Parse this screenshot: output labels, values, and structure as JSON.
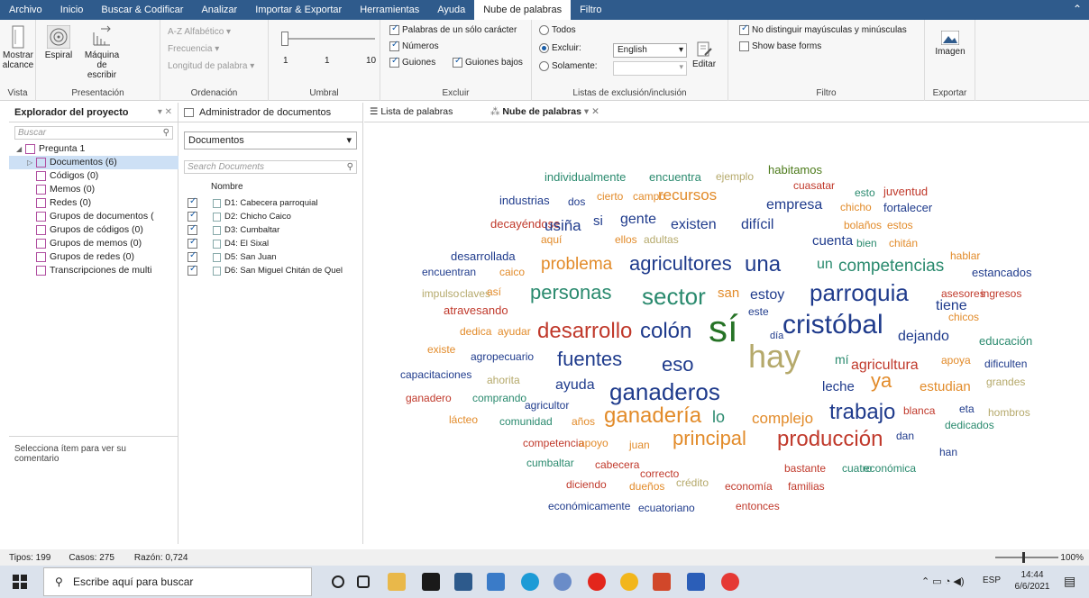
{
  "menu": {
    "tabs": [
      "Archivo",
      "Inicio",
      "Buscar & Codificar",
      "Analizar",
      "Importar & Exportar",
      "Herramientas",
      "Ayuda",
      "Nube de palabras",
      "Filtro"
    ],
    "active": "Nube de palabras"
  },
  "ribbon": {
    "vista": {
      "label": "Vista",
      "mostrar": "Mostrar alcance"
    },
    "presentacion": {
      "label": "Presentación",
      "espiral": "Espiral",
      "maquina": "Máquina de escribir"
    },
    "ordenacion": {
      "label": "Ordenación",
      "alfabetico": "A-Z Alfabético",
      "frecuencia": "Frecuencia",
      "longitud": "Longitud de palabra"
    },
    "umbral": {
      "label": "Umbral",
      "tick_min": "1",
      "tick_mid": "1",
      "tick_max": "10",
      "value": 1
    },
    "excluir": {
      "label": "Excluir",
      "palabras": "Palabras de un sólo carácter",
      "numeros": "Números",
      "guiones": "Guiones",
      "guiones_bajos": "Guiones bajos"
    },
    "listas": {
      "label": "Listas de exclusión/inclusión",
      "todos": "Todos",
      "excluir": "Excluir:",
      "solamente": "Solamente:",
      "language": "English",
      "editar": "Editar"
    },
    "filtro": {
      "label": "Filtro",
      "no_distinguir": "No distinguir mayúsculas y minúsculas",
      "show_base": "Show base forms"
    },
    "exportar": {
      "label": "Exportar",
      "imagen": "Imagen"
    }
  },
  "left_pane": {
    "title": "Explorador del proyecto",
    "search_placeholder": "Buscar",
    "tree": [
      {
        "label": "Pregunta 1",
        "level": 0
      },
      {
        "label": "Documentos (6)",
        "level": 1,
        "selected": true
      },
      {
        "label": "Códigos (0)",
        "level": 1
      },
      {
        "label": "Memos (0)",
        "level": 1
      },
      {
        "label": "Redes (0)",
        "level": 1
      },
      {
        "label": "Grupos de documentos (",
        "level": 1
      },
      {
        "label": "Grupos de códigos (0)",
        "level": 1
      },
      {
        "label": "Grupos de memos (0)",
        "level": 1
      },
      {
        "label": "Grupos de redes (0)",
        "level": 1
      },
      {
        "label": "Transcripciones de multi",
        "level": 1
      }
    ],
    "comment_hint": "Selecciona ítem para ver su comentario"
  },
  "mid_pane": {
    "tab_label": "Administrador de documentos",
    "dropdown": "Documentos",
    "search_placeholder": "Search Documents",
    "column": "Nombre",
    "docs": [
      "D1: Cabecera parroquial",
      "D2: Chicho Caico",
      "D3: Cumbaltar",
      "D4: El Sixal",
      "D5: San Juan",
      "D6: San Miguel Chitán de Quel"
    ]
  },
  "tabs": {
    "lista": "Lista de palabras",
    "nube": "Nube de palabras"
  },
  "cloud": [
    {
      "t": "individualmente",
      "c": "#2a8a6e",
      "s": 13
    },
    {
      "t": "encuentra",
      "c": "#2a8a6e",
      "s": 13
    },
    {
      "t": "ejemplo",
      "c": "#b5a96b",
      "s": 12
    },
    {
      "t": "habitamos",
      "c": "#4c7a1a",
      "s": 13
    },
    {
      "t": "cuasatar",
      "c": "#c0392b",
      "s": 12
    },
    {
      "t": "esto",
      "c": "#2a8a6e",
      "s": 12
    },
    {
      "t": "juventud",
      "c": "#c0392b",
      "s": 13
    },
    {
      "t": "industrias",
      "c": "#1f3b8c",
      "s": 13
    },
    {
      "t": "dos",
      "c": "#1f3b8c",
      "s": 12
    },
    {
      "t": "cierto",
      "c": "#e28b2a",
      "s": 12
    },
    {
      "t": "campo",
      "c": "#e28b2a",
      "s": 12
    },
    {
      "t": "recursos",
      "c": "#e28b2a",
      "s": 17
    },
    {
      "t": "empresa",
      "c": "#1f3b8c",
      "s": 16
    },
    {
      "t": "chicho",
      "c": "#e28b2a",
      "s": 12
    },
    {
      "t": "fortalecer",
      "c": "#1f3b8c",
      "s": 13
    },
    {
      "t": "decayéndose",
      "c": "#c0392b",
      "s": 13
    },
    {
      "t": "usiña",
      "c": "#1f3b8c",
      "s": 17
    },
    {
      "t": "si",
      "c": "#1f3b8c",
      "s": 15
    },
    {
      "t": "gente",
      "c": "#1f3b8c",
      "s": 16
    },
    {
      "t": "existen",
      "c": "#1f3b8c",
      "s": 16
    },
    {
      "t": "difícil",
      "c": "#1f3b8c",
      "s": 16
    },
    {
      "t": "bolaños",
      "c": "#e28b2a",
      "s": 12
    },
    {
      "t": "estos",
      "c": "#e28b2a",
      "s": 12
    },
    {
      "t": "aquí",
      "c": "#e28b2a",
      "s": 12
    },
    {
      "t": "ellos",
      "c": "#e28b2a",
      "s": 12
    },
    {
      "t": "adultas",
      "c": "#b5a96b",
      "s": 12
    },
    {
      "t": "cuenta",
      "c": "#1f3b8c",
      "s": 15
    },
    {
      "t": "bien",
      "c": "#2a8a6e",
      "s": 12
    },
    {
      "t": "chitán",
      "c": "#e28b2a",
      "s": 12
    },
    {
      "t": "desarrollada",
      "c": "#1f3b8c",
      "s": 13
    },
    {
      "t": "hablar",
      "c": "#e28b2a",
      "s": 12
    },
    {
      "t": "encuentran",
      "c": "#1f3b8c",
      "s": 12
    },
    {
      "t": "caico",
      "c": "#e28b2a",
      "s": 12
    },
    {
      "t": "problema",
      "c": "#e28b2a",
      "s": 19
    },
    {
      "t": "agricultores",
      "c": "#1f3b8c",
      "s": 22
    },
    {
      "t": "una",
      "c": "#1f3b8c",
      "s": 24
    },
    {
      "t": "un",
      "c": "#2a8a6e",
      "s": 16
    },
    {
      "t": "competencias",
      "c": "#2a8a6e",
      "s": 19
    },
    {
      "t": "estancados",
      "c": "#1f3b8c",
      "s": 13
    },
    {
      "t": "impulso",
      "c": "#b5a96b",
      "s": 12
    },
    {
      "t": "claves",
      "c": "#b5a96b",
      "s": 12
    },
    {
      "t": "así",
      "c": "#e28b2a",
      "s": 12
    },
    {
      "t": "personas",
      "c": "#2a8a6e",
      "s": 22
    },
    {
      "t": "sector",
      "c": "#2a8a6e",
      "s": 26
    },
    {
      "t": "san",
      "c": "#e28b2a",
      "s": 15
    },
    {
      "t": "estoy",
      "c": "#1f3b8c",
      "s": 16
    },
    {
      "t": "parroquia",
      "c": "#1f3b8c",
      "s": 26
    },
    {
      "t": "asesores",
      "c": "#c0392b",
      "s": 12
    },
    {
      "t": "ingresos",
      "c": "#c0392b",
      "s": 12
    },
    {
      "t": "atravesando",
      "c": "#c0392b",
      "s": 13
    },
    {
      "t": "este",
      "c": "#1f3b8c",
      "s": 12
    },
    {
      "t": "tiene",
      "c": "#1f3b8c",
      "s": 16
    },
    {
      "t": "chicos",
      "c": "#e28b2a",
      "s": 12
    },
    {
      "t": "dedica",
      "c": "#e28b2a",
      "s": 12
    },
    {
      "t": "ayudar",
      "c": "#e28b2a",
      "s": 12
    },
    {
      "t": "desarrollo",
      "c": "#c0392b",
      "s": 24
    },
    {
      "t": "colón",
      "c": "#1f3b8c",
      "s": 24
    },
    {
      "t": "sí",
      "c": "#267326",
      "s": 42
    },
    {
      "t": "día",
      "c": "#1f3b8c",
      "s": 11
    },
    {
      "t": "cristóbal",
      "c": "#1f3b8c",
      "s": 30
    },
    {
      "t": "dejando",
      "c": "#1f3b8c",
      "s": 16
    },
    {
      "t": "educación",
      "c": "#2a8a6e",
      "s": 13
    },
    {
      "t": "existe",
      "c": "#e28b2a",
      "s": 12
    },
    {
      "t": "agropecuario",
      "c": "#1f3b8c",
      "s": 12
    },
    {
      "t": "fuentes",
      "c": "#1f3b8c",
      "s": 22
    },
    {
      "t": "eso",
      "c": "#1f3b8c",
      "s": 22
    },
    {
      "t": "hay",
      "c": "#b5a96b",
      "s": 36
    },
    {
      "t": "mí",
      "c": "#2a8a6e",
      "s": 14
    },
    {
      "t": "agricultura",
      "c": "#c0392b",
      "s": 16
    },
    {
      "t": "apoya",
      "c": "#e28b2a",
      "s": 12
    },
    {
      "t": "dificulten",
      "c": "#1f3b8c",
      "s": 12
    },
    {
      "t": "capacitaciones",
      "c": "#1f3b8c",
      "s": 12
    },
    {
      "t": "ahorita",
      "c": "#b5a96b",
      "s": 12
    },
    {
      "t": "ayuda",
      "c": "#1f3b8c",
      "s": 16
    },
    {
      "t": "ganaderos",
      "c": "#1f3b8c",
      "s": 26
    },
    {
      "t": "leche",
      "c": "#1f3b8c",
      "s": 15
    },
    {
      "t": "ya",
      "c": "#e28b2a",
      "s": 22
    },
    {
      "t": "estudian",
      "c": "#e28b2a",
      "s": 15
    },
    {
      "t": "grandes",
      "c": "#b5a96b",
      "s": 12
    },
    {
      "t": "ganadero",
      "c": "#c0392b",
      "s": 12
    },
    {
      "t": "comprando",
      "c": "#2a8a6e",
      "s": 12
    },
    {
      "t": "agricultor",
      "c": "#1f3b8c",
      "s": 12
    },
    {
      "t": "lácteo",
      "c": "#e28b2a",
      "s": 12
    },
    {
      "t": "comunidad",
      "c": "#2a8a6e",
      "s": 12
    },
    {
      "t": "años",
      "c": "#e28b2a",
      "s": 12
    },
    {
      "t": "ganadería",
      "c": "#e28b2a",
      "s": 24
    },
    {
      "t": "lo",
      "c": "#2a8a6e",
      "s": 18
    },
    {
      "t": "complejo",
      "c": "#e28b2a",
      "s": 17
    },
    {
      "t": "trabajo",
      "c": "#1f3b8c",
      "s": 24
    },
    {
      "t": "blanca",
      "c": "#c0392b",
      "s": 12
    },
    {
      "t": "eta",
      "c": "#1f3b8c",
      "s": 12
    },
    {
      "t": "hombros",
      "c": "#b5a96b",
      "s": 12
    },
    {
      "t": "dedicados",
      "c": "#2a8a6e",
      "s": 12
    },
    {
      "t": "competencia",
      "c": "#c0392b",
      "s": 12
    },
    {
      "t": "apoyo",
      "c": "#e28b2a",
      "s": 12
    },
    {
      "t": "juan",
      "c": "#e28b2a",
      "s": 12
    },
    {
      "t": "principal",
      "c": "#e28b2a",
      "s": 22
    },
    {
      "t": "producción",
      "c": "#c0392b",
      "s": 24
    },
    {
      "t": "dan",
      "c": "#1f3b8c",
      "s": 12
    },
    {
      "t": "han",
      "c": "#1f3b8c",
      "s": 12
    },
    {
      "t": "cumbaltar",
      "c": "#2a8a6e",
      "s": 12
    },
    {
      "t": "cabecera",
      "c": "#c0392b",
      "s": 12
    },
    {
      "t": "correcto",
      "c": "#c0392b",
      "s": 12
    },
    {
      "t": "bastante",
      "c": "#c0392b",
      "s": 12
    },
    {
      "t": "cuatro",
      "c": "#2a8a6e",
      "s": 12
    },
    {
      "t": "económica",
      "c": "#2a8a6e",
      "s": 12
    },
    {
      "t": "diciendo",
      "c": "#c0392b",
      "s": 12
    },
    {
      "t": "dueños",
      "c": "#e28b2a",
      "s": 12
    },
    {
      "t": "crédito",
      "c": "#b5a96b",
      "s": 12
    },
    {
      "t": "economía",
      "c": "#c0392b",
      "s": 12
    },
    {
      "t": "familias",
      "c": "#c0392b",
      "s": 12
    },
    {
      "t": "económicamente",
      "c": "#1f3b8c",
      "s": 12
    },
    {
      "t": "ecuatoriano",
      "c": "#1f3b8c",
      "s": 12
    },
    {
      "t": "entonces",
      "c": "#c0392b",
      "s": 12
    }
  ],
  "status": {
    "tipos": "Tipos: 199",
    "casos": "Casos: 275",
    "razon": "Razón: 0,724",
    "zoom": "100%"
  },
  "taskbar": {
    "search": "Escribe aquí para buscar",
    "lang": "ESP",
    "time": "14:44",
    "date": "6/6/2021"
  }
}
